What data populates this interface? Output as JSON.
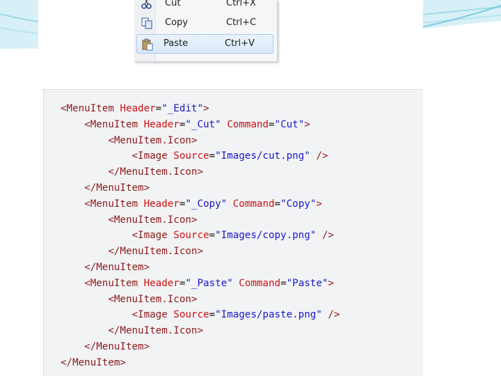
{
  "colors": {
    "tag": "#8b1a1a",
    "attr": "#cc1111",
    "value": "#1616c8",
    "menu_highlight": "#d9e9fb"
  },
  "menu": {
    "items": [
      {
        "label": "Cut",
        "shortcut": "Ctrl+X",
        "icon": "scissors-icon",
        "selected": false
      },
      {
        "label": "Copy",
        "shortcut": "Ctrl+C",
        "icon": "copy-icon",
        "selected": false
      },
      {
        "label": "Paste",
        "shortcut": "Ctrl+V",
        "icon": "clipboard-icon",
        "selected": true
      }
    ]
  },
  "code": {
    "lines": [
      [
        [
          "tag",
          "<MenuItem "
        ],
        [
          "attr",
          "Header"
        ],
        [
          "punc",
          "="
        ],
        [
          "val",
          "\"_Edit\""
        ],
        [
          "tag",
          ">"
        ]
      ],
      [
        [
          "tag",
          "    <MenuItem "
        ],
        [
          "attr",
          "Header"
        ],
        [
          "punc",
          "="
        ],
        [
          "val",
          "\"_Cut\" "
        ],
        [
          "attr",
          "Command"
        ],
        [
          "punc",
          "="
        ],
        [
          "val",
          "\"Cut\""
        ],
        [
          "tag",
          ">"
        ]
      ],
      [
        [
          "tag",
          "        <MenuItem.Icon>"
        ]
      ],
      [
        [
          "tag",
          "            <Image "
        ],
        [
          "attr",
          "Source"
        ],
        [
          "punc",
          "="
        ],
        [
          "val",
          "\"Images/cut.png\" "
        ],
        [
          "tag",
          "/>"
        ]
      ],
      [
        [
          "tag",
          "        </MenuItem.Icon>"
        ]
      ],
      [
        [
          "tag",
          "    </MenuItem>"
        ]
      ],
      [
        [
          "tag",
          "    <MenuItem "
        ],
        [
          "attr",
          "Header"
        ],
        [
          "punc",
          "="
        ],
        [
          "val",
          "\"_Copy\" "
        ],
        [
          "attr",
          "Command"
        ],
        [
          "punc",
          "="
        ],
        [
          "val",
          "\"Copy\""
        ],
        [
          "tag",
          ">"
        ]
      ],
      [
        [
          "tag",
          "        <MenuItem.Icon>"
        ]
      ],
      [
        [
          "tag",
          "            <Image "
        ],
        [
          "attr",
          "Source"
        ],
        [
          "punc",
          "="
        ],
        [
          "val",
          "\"Images/copy.png\" "
        ],
        [
          "tag",
          "/>"
        ]
      ],
      [
        [
          "tag",
          "        </MenuItem.Icon>"
        ]
      ],
      [
        [
          "tag",
          "    </MenuItem>"
        ]
      ],
      [
        [
          "tag",
          "    <MenuItem "
        ],
        [
          "attr",
          "Header"
        ],
        [
          "punc",
          "="
        ],
        [
          "val",
          "\"_Paste\" "
        ],
        [
          "attr",
          "Command"
        ],
        [
          "punc",
          "="
        ],
        [
          "val",
          "\"Paste\""
        ],
        [
          "tag",
          ">"
        ]
      ],
      [
        [
          "tag",
          "        <MenuItem.Icon>"
        ]
      ],
      [
        [
          "tag",
          "            <Image "
        ],
        [
          "attr",
          "Source"
        ],
        [
          "punc",
          "="
        ],
        [
          "val",
          "\"Images/paste.png\" "
        ],
        [
          "tag",
          "/>"
        ]
      ],
      [
        [
          "tag",
          "        </MenuItem.Icon>"
        ]
      ],
      [
        [
          "tag",
          "    </MenuItem>"
        ]
      ],
      [
        [
          "tag",
          "</MenuItem>"
        ]
      ]
    ]
  }
}
